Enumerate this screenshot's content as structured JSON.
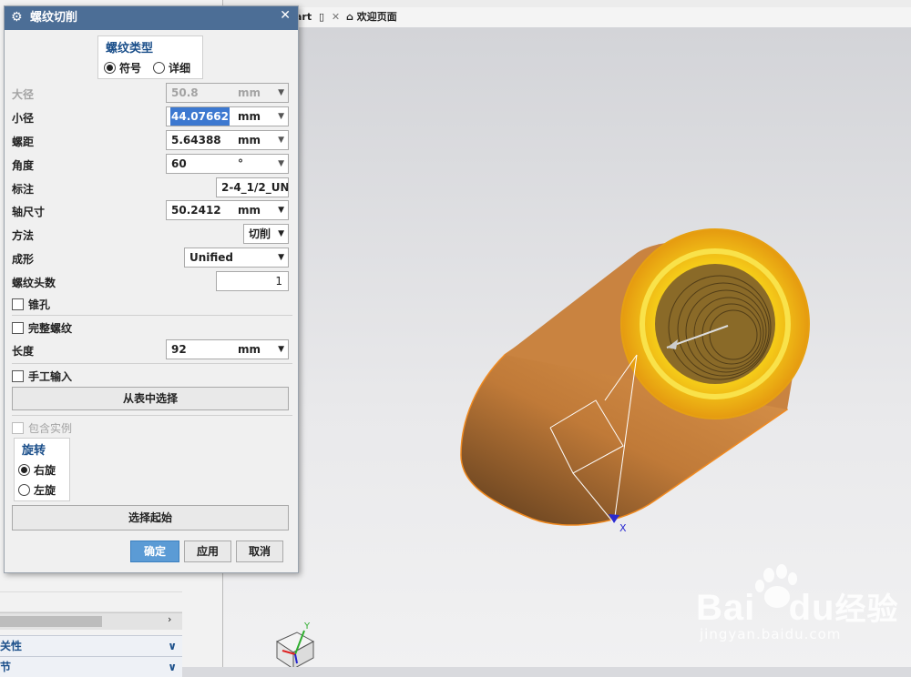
{
  "tabs": {
    "part_tab": "art",
    "welcome_tab": "欢迎页面"
  },
  "dialog": {
    "title": "螺纹切削",
    "thread_type": {
      "title": "螺纹类型",
      "options": [
        "符号",
        "详细"
      ],
      "selected": "符号"
    },
    "fields": {
      "major_diameter": {
        "label": "大径",
        "value": "50.8",
        "unit": "mm"
      },
      "minor_diameter": {
        "label": "小径",
        "value": "44.07662",
        "unit": "mm"
      },
      "pitch": {
        "label": "螺距",
        "value": "5.64388",
        "unit": "mm"
      },
      "angle": {
        "label": "角度",
        "value": "60",
        "unit": "°"
      },
      "callout": {
        "label": "标注",
        "value": "2-4_1/2_UN("
      },
      "shaft_size": {
        "label": "轴尺寸",
        "value": "50.2412",
        "unit": "mm"
      },
      "method": {
        "label": "方法",
        "value": "切削"
      },
      "form": {
        "label": "成形",
        "value": "Unified"
      },
      "starts": {
        "label": "螺纹头数",
        "value": "1"
      },
      "length": {
        "label": "长度",
        "value": "92",
        "unit": "mm"
      }
    },
    "checkboxes": {
      "tapered": "锥孔",
      "full_thread": "完整螺纹",
      "manual_input": "手工输入",
      "include_instances": "包含实例"
    },
    "choose_from_table": "从表中选择",
    "rotation": {
      "title": "旋转",
      "options": [
        "右旋",
        "左旋"
      ],
      "selected": "右旋"
    },
    "select_start": "选择起始",
    "buttons": {
      "ok": "确定",
      "apply": "应用",
      "cancel": "取消"
    }
  },
  "left_panel": {
    "sections": [
      "关性",
      "节"
    ]
  },
  "viewport": {
    "axis_x": "X",
    "axis_y": "Y"
  },
  "watermark": {
    "brand": "Bai",
    "brand2": "du",
    "suffix": "经验",
    "url": "jingyan.baidu.com"
  },
  "colors": {
    "titlebar": "#4c6e96",
    "primary_button": "#5b9bd5",
    "model_body": "#d08a45",
    "model_face": "#f5c518"
  }
}
